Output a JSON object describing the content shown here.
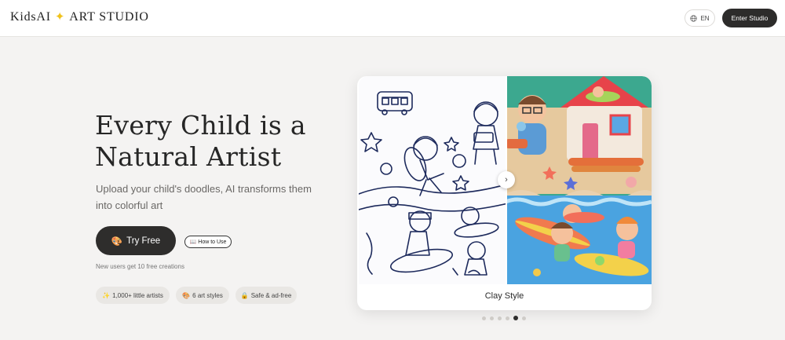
{
  "header": {
    "logo_left": "KidsAI",
    "logo_spark": "✦",
    "logo_right": "ART STUDIO",
    "lang_label": "EN",
    "enter_label": "Enter Studio"
  },
  "hero": {
    "title_line1": "Every Child is a",
    "title_line2": "Natural Artist",
    "subtitle_line1": "Upload your child's doodles, AI transforms them",
    "subtitle_line2": "into colorful art",
    "try_icon": "🎨",
    "try_label": "Try Free",
    "howto_icon": "📖",
    "howto_label": "How to Use",
    "new_user_note": "New users get 10 free creations"
  },
  "badges": [
    {
      "icon": "✨",
      "label": "1,000+ little artists"
    },
    {
      "icon": "🎨",
      "label": "6 art styles"
    },
    {
      "icon": "🔒",
      "label": "Safe & ad-free"
    }
  ],
  "showcase": {
    "style_label": "Clay Style",
    "handle_icon": "›",
    "slide_count": 6,
    "active_slide": 5
  },
  "colors": {
    "accent_dark": "#2e2d2c",
    "spark_yellow": "#f0c21b",
    "page_bg": "#f4f3f2"
  }
}
